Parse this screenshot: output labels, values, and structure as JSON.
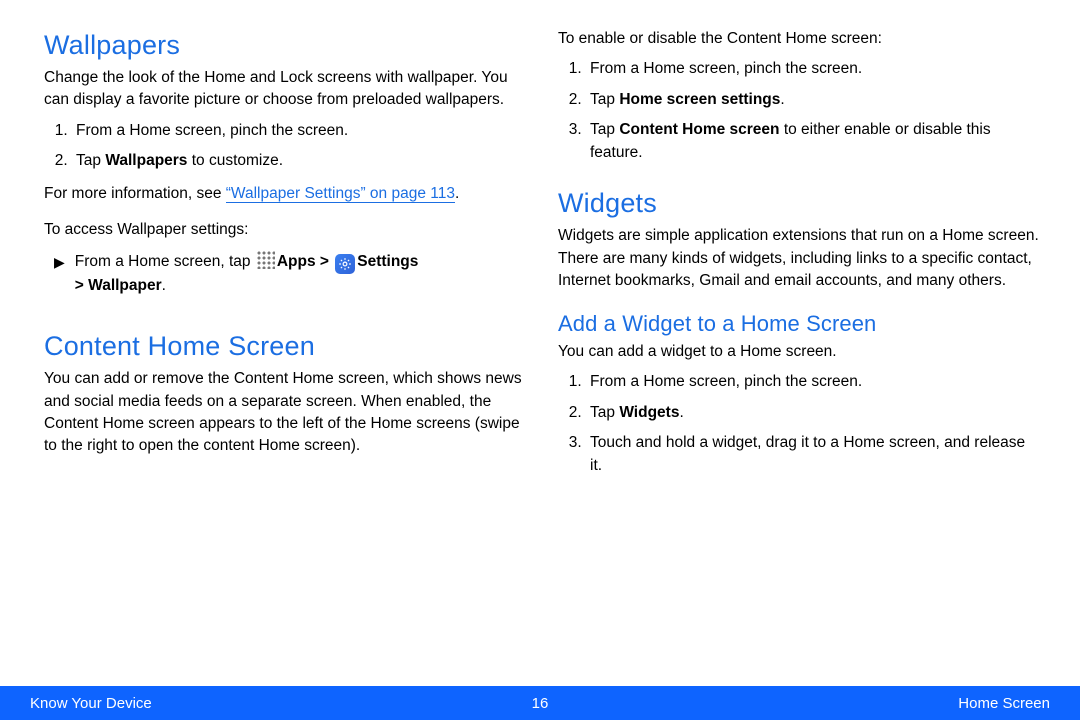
{
  "left": {
    "wallpapers": {
      "title": "Wallpapers",
      "intro": "Change the look of the Home and Lock screens with wallpaper. You can display a favorite picture or choose from preloaded wallpapers.",
      "steps": {
        "s1": "From a Home screen, pinch the screen.",
        "s2_pre": "Tap ",
        "s2_bold": "Wallpapers",
        "s2_post": " to customize."
      },
      "more_pre": "For more information, see ",
      "more_link": "“Wallpaper Settings” on page 113",
      "more_post": ".",
      "access": "To access Wallpaper settings:",
      "path_pre": "From a Home screen, tap ",
      "path_apps": "Apps",
      "path_gt1": " > ",
      "path_settings": "Settings",
      "path_gt2": "\n> ",
      "path_wallpaper": "Wallpaper",
      "path_post": "."
    },
    "contentHome": {
      "title": "Content Home Screen",
      "intro": "You can add or remove the Content Home screen, which shows news and social media feeds on a separate screen. When enabled, the Content Home screen appears to the left of the Home screens (swipe to the right to open the content Home screen)."
    }
  },
  "right": {
    "enable": {
      "intro": "To enable or disable the Content Home screen:",
      "s1": "From a Home screen, pinch the screen.",
      "s2_pre": "Tap ",
      "s2_bold": "Home screen settings",
      "s2_post": ".",
      "s3_pre": "Tap ",
      "s3_bold": "Content Home screen",
      "s3_post": " to either enable or disable this feature."
    },
    "widgets": {
      "title": "Widgets",
      "intro": "Widgets are simple application extensions that run on a Home screen. There are many kinds of widgets, including links to a specific contact, Internet bookmarks, Gmail and email accounts, and many others."
    },
    "addWidget": {
      "title": "Add a Widget to a Home Screen",
      "intro": "You can add a widget to a Home screen.",
      "s1": "From a Home screen, pinch the screen.",
      "s2_pre": "Tap ",
      "s2_bold": "Widgets",
      "s2_post": ".",
      "s3": "Touch and hold a widget, drag it to a Home screen, and release it."
    }
  },
  "footer": {
    "left": "Know Your Device",
    "center": "16",
    "right": "Home Screen"
  }
}
